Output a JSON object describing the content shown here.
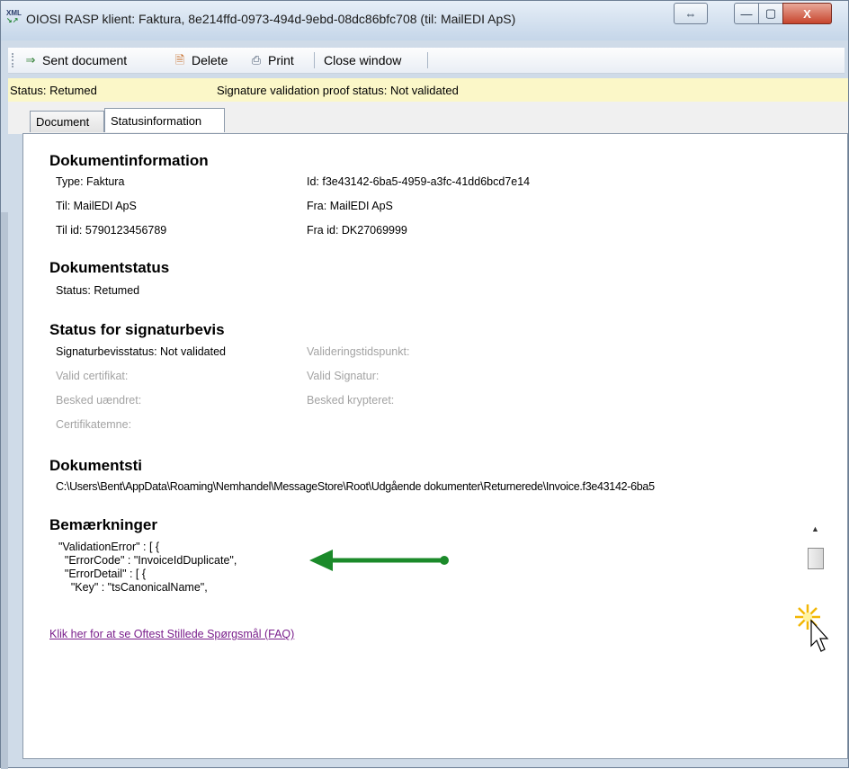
{
  "window": {
    "title": "OIOSI RASP klient: Faktura, 8e214ffd-0973-494d-9ebd-08dc86bfc708 (til: MailEDI ApS)",
    "icon_name": "xml-file-icon",
    "controls": {
      "resize": "⇔",
      "minimize": "—",
      "maximize": "▢",
      "close": "X"
    }
  },
  "toolbar": {
    "sent_label": "Sent document",
    "delete_label": "Delete",
    "print_label": "Print",
    "close_label": "Close window"
  },
  "statusbar": {
    "status": "Status:  Retumed",
    "signature": "Signature validation proof status:  Not validated"
  },
  "tabs": [
    {
      "label": "Document"
    },
    {
      "label": "Statusinformation",
      "active": true
    }
  ],
  "dokumentinformation": {
    "heading": "Dokumentinformation",
    "type": "Type:  Faktura",
    "til": "Til:  MailEDI ApS",
    "til_id": "Til id:  5790123456789",
    "id": "Id:  f3e43142-6ba5-4959-a3fc-41dd6bcd7e14",
    "fra": "Fra:  MailEDI ApS",
    "fra_id": "Fra id:  DK27069999"
  },
  "dokumentstatus": {
    "heading": "Dokumentstatus",
    "status": "Status:  Retumed"
  },
  "signaturbevis": {
    "heading": "Status for signaturbevis",
    "signaturbevisstatus": "Signaturbevisstatus:  Not validated",
    "valideringstidspunkt": "Valideringstidspunkt:",
    "valid_certifikat": "Valid certifikat:",
    "valid_signatur": "Valid Signatur:",
    "besked_uaendret": "Besked uændret:",
    "besked_krypteret": "Besked krypteret:",
    "certifikatemne": "Certifikatemne:"
  },
  "dokumentsti": {
    "heading": "Dokumentsti",
    "path": "C:\\Users\\Bent\\AppData\\Roaming\\Nemhandel\\MessageStore\\Root\\Udgående dokumenter\\Returnerede\\Invoice.f3e43142-6ba5"
  },
  "bemaerkninger": {
    "heading": "Bemærkninger",
    "lines": [
      "  \"ValidationError\" : [ {",
      "    \"ErrorCode\" : \"InvoiceIdDuplicate\",",
      "    \"ErrorDetail\" : [ {",
      "      \"Key\" : \"tsCanonicalName\","
    ]
  },
  "faq_link": "Klik her for at se Oftest Stillede Spørgsmål (FAQ)",
  "colors": {
    "arrow": "#1b8a2a",
    "link": "#7a1f8c",
    "statusbar": "#fbf7c8"
  }
}
